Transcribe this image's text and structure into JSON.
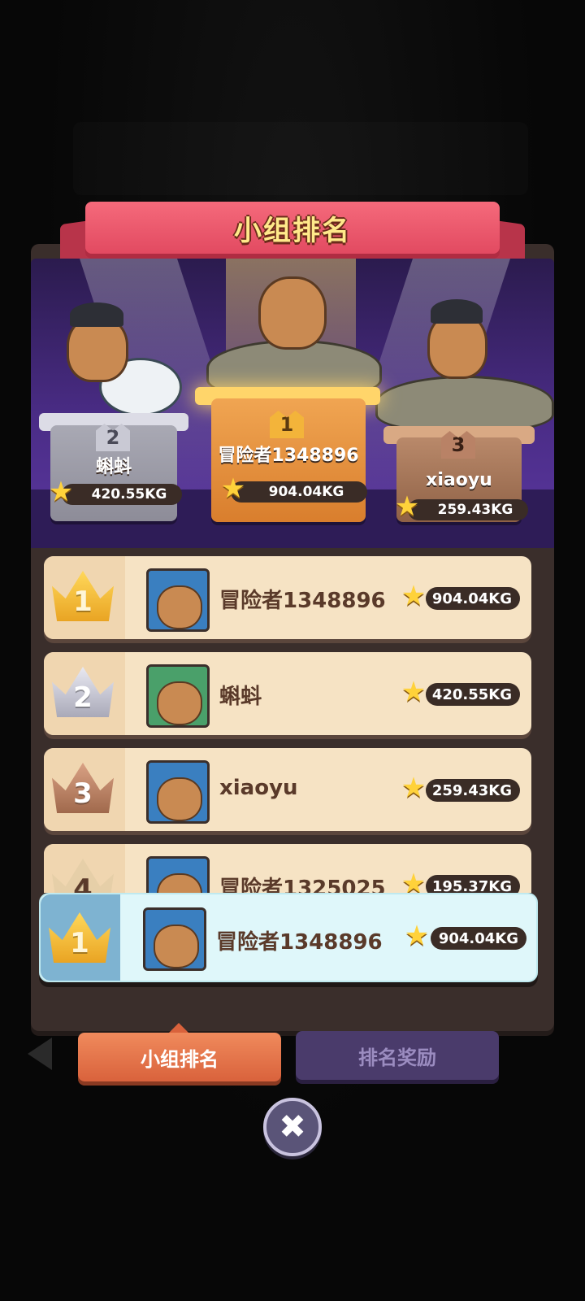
{
  "title": "小组排名",
  "podium": {
    "first": {
      "rank": "1",
      "name": "冒险者1348896",
      "score": "904.04KG"
    },
    "second": {
      "rank": "2",
      "name": "蝌蚪",
      "score": "420.55KG"
    },
    "third": {
      "rank": "3",
      "name": "xiaoyu",
      "score": "259.43KG"
    }
  },
  "rankings": [
    {
      "rank": "1",
      "name": "冒险者1348896",
      "score": "904.04KG"
    },
    {
      "rank": "2",
      "name": "蝌蚪",
      "score": "420.55KG"
    },
    {
      "rank": "3",
      "name": "xiaoyu",
      "score": "259.43KG"
    },
    {
      "rank": "4",
      "name": "冒险者1325025",
      "score": "195.37KG"
    }
  ],
  "my_entry": {
    "rank": "1",
    "name": "冒险者1348896",
    "score": "904.04KG"
  },
  "tabs": {
    "group_ranking": "小组排名",
    "ranking_rewards": "排名奖励"
  },
  "close_label": "✖",
  "icons": {
    "star": "★",
    "close": "close-icon",
    "crown": "crown-icon",
    "back": "chevron-left-icon"
  },
  "colors": {
    "banner": "#e24a61",
    "banner_title": "#ffe98a",
    "stage": "#4a2c86",
    "row_bg": "#f6e3c4",
    "my_row_bg": "#dff7fa",
    "active_tab": "#d9623c",
    "inactive_tab": "#4a3b6b"
  }
}
